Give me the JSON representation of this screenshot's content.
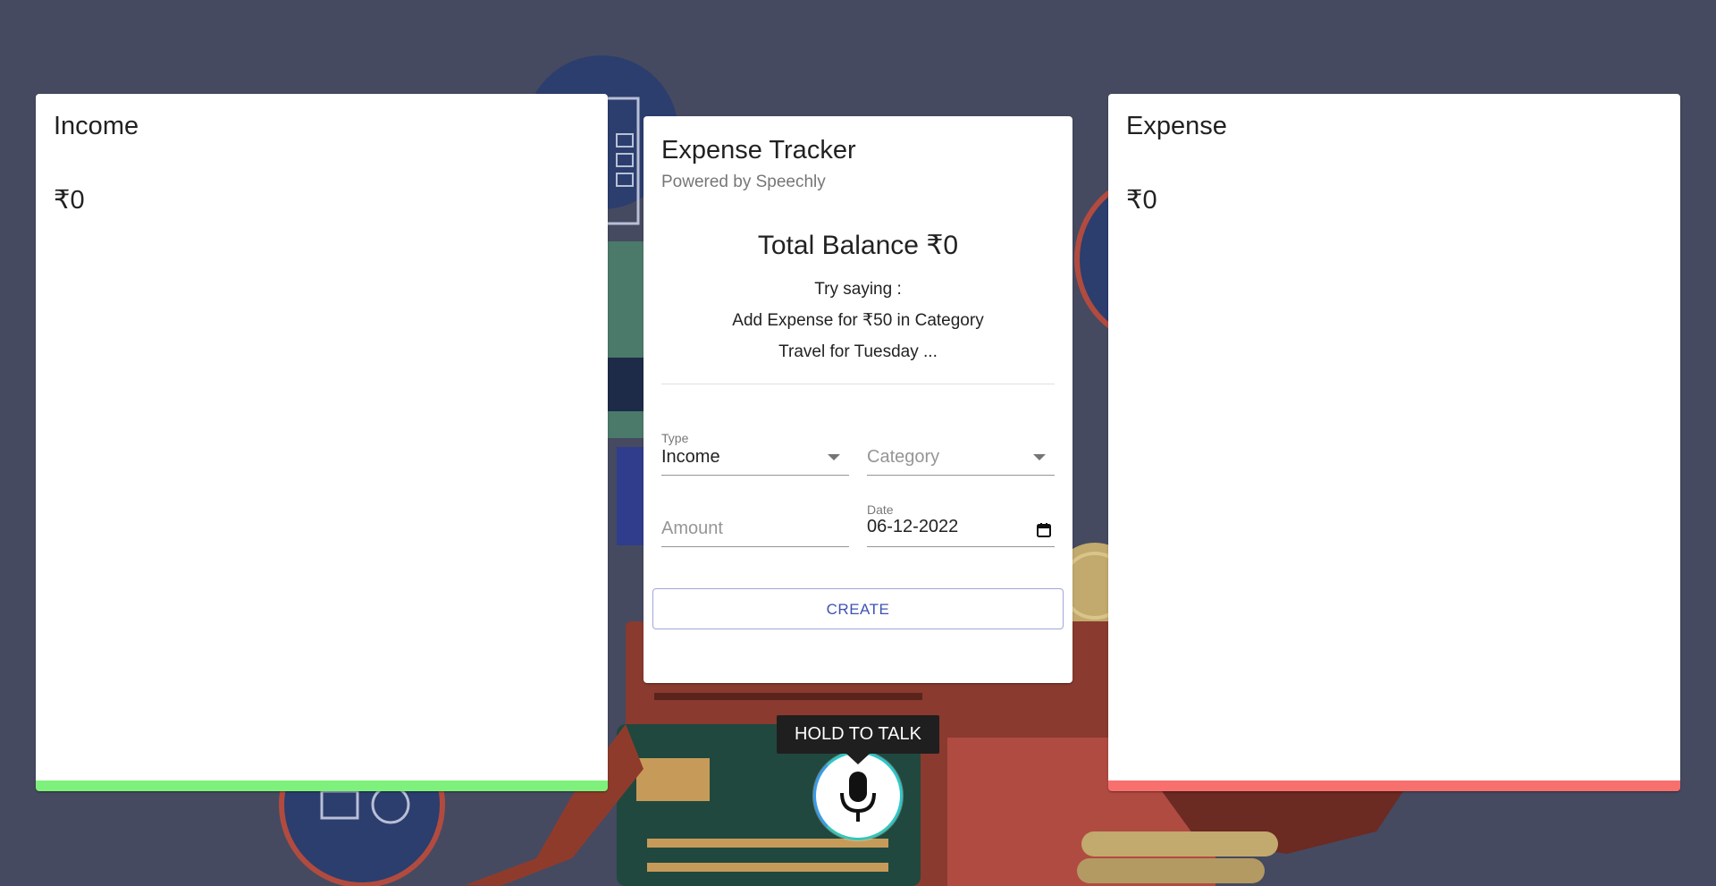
{
  "income_card": {
    "title": "Income",
    "amount": "₹0",
    "accent": "#7df17b"
  },
  "expense_card": {
    "title": "Expense",
    "amount": "₹0",
    "accent": "#f8706d"
  },
  "tracker": {
    "title": "Expense Tracker",
    "subtitle": "Powered by Speechly",
    "balance": "Total Balance ₹0",
    "hint_line1": "Try saying :",
    "hint_line2": "Add Expense for ₹50 in Category",
    "hint_line3": "Travel for Tuesday ...",
    "form": {
      "type_label": "Type",
      "type_value": "Income",
      "category_placeholder": "Category",
      "amount_placeholder": "Amount",
      "date_label": "Date",
      "date_value": "06-12-2022",
      "create_label": "CREATE"
    }
  },
  "voice": {
    "tooltip": "HOLD TO TALK",
    "icon": "microphone-icon"
  },
  "colors": {
    "background": "#454a60",
    "primary": "#3f51b5"
  }
}
